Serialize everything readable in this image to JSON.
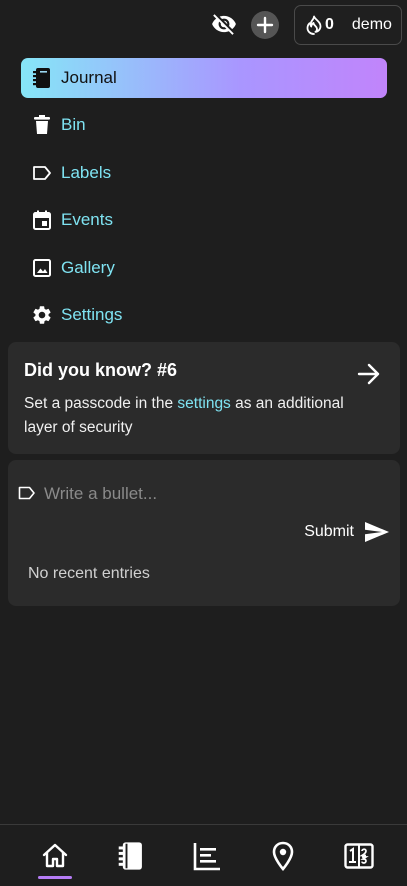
{
  "header": {
    "streak_count": "0",
    "username": "demo"
  },
  "nav": {
    "items": [
      {
        "label": "Journal",
        "icon": "journal-icon",
        "active": true
      },
      {
        "label": "Bin",
        "icon": "bin-icon"
      },
      {
        "label": "Labels",
        "icon": "label-icon"
      },
      {
        "label": "Events",
        "icon": "calendar-icon"
      },
      {
        "label": "Gallery",
        "icon": "image-icon"
      },
      {
        "label": "Settings",
        "icon": "gear-icon"
      }
    ]
  },
  "tip": {
    "title": "Did you know? #6",
    "text_before": "Set a passcode in the ",
    "link": "settings",
    "text_after": " as an additional layer of security"
  },
  "entry": {
    "placeholder": "Write a bullet...",
    "submit_label": "Submit",
    "empty_text": "No recent entries"
  },
  "bottom_nav": {
    "items": [
      "home-icon",
      "journal-icon",
      "timeline-icon",
      "location-icon",
      "number-icon"
    ],
    "active": "home-icon",
    "accent_color": "#b57cf5"
  },
  "colors": {
    "background": "#1e1e1e",
    "card": "#2b2b2b",
    "link": "#7fe3f2",
    "active_gradient_start": "#86e6f7",
    "active_gradient_end": "#c184fb"
  }
}
